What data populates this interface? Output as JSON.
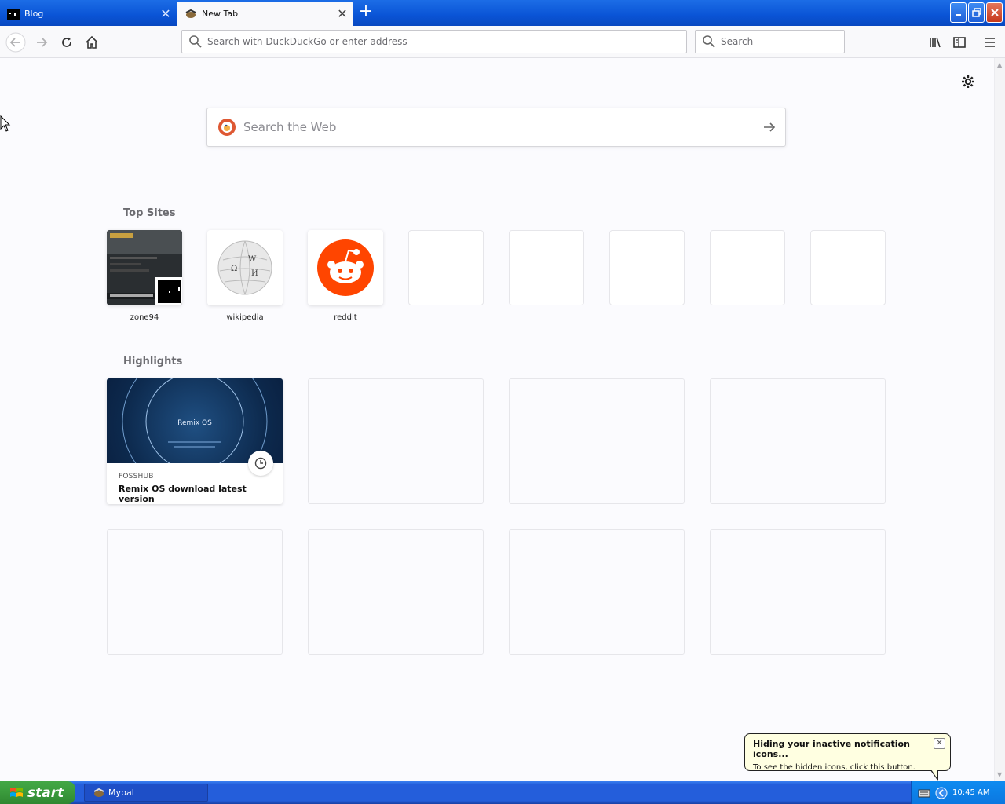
{
  "tabs": [
    {
      "label": "Blog",
      "active": false
    },
    {
      "label": "New Tab",
      "active": true
    }
  ],
  "navbar": {
    "url_placeholder": "Search with DuckDuckGo or enter address",
    "search_placeholder": "Search"
  },
  "newtab": {
    "web_search_placeholder": "Search the Web",
    "top_sites_title": "Top Sites",
    "top_sites": [
      {
        "name": "zone94"
      },
      {
        "name": "wikipedia"
      },
      {
        "name": "reddit"
      }
    ],
    "highlights_title": "Highlights",
    "highlight": {
      "thumb_text": "Remix OS",
      "source": "FOSSHUB",
      "title": "Remix OS download latest version"
    }
  },
  "balloon": {
    "title": "Hiding your inactive notification icons...",
    "text": "To see the hidden icons, click this button."
  },
  "taskbar": {
    "start_label": "start",
    "task_item": "Mypal",
    "clock": "10:45 AM"
  },
  "colors": {
    "accent_blue": "#245edb",
    "reddit_orange": "#ff4500",
    "start_green": "#3a9a3c"
  }
}
